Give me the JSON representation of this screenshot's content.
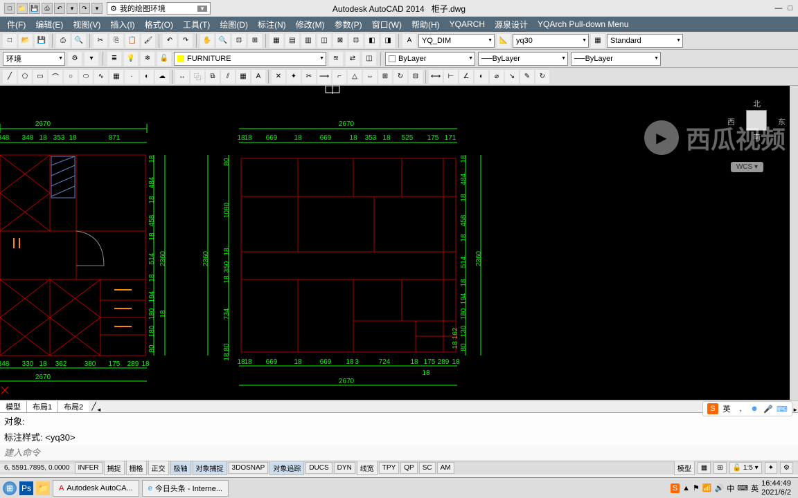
{
  "title": {
    "app": "Autodesk AutoCAD 2014",
    "file": "柜子.dwg"
  },
  "workspace": "我的绘图环境",
  "menus": [
    "件(F)",
    "编辑(E)",
    "视图(V)",
    "插入(I)",
    "格式(O)",
    "工具(T)",
    "绘图(D)",
    "标注(N)",
    "修改(M)",
    "参数(P)",
    "窗口(W)",
    "帮助(H)",
    "YQARCH",
    "源泉设计",
    "YQArch Pull-down Menu"
  ],
  "style_dd": {
    "text": "YQ_DIM",
    "style2": "yq30",
    "std": "Standard"
  },
  "layer": {
    "env": "环境",
    "current": "FURNITURE",
    "bylayer": "ByLayer",
    "bylayer2": "ByLayer",
    "bylayer3": "ByLayer"
  },
  "cmd": {
    "l1": "对象:",
    "l2": "标注样式:  <yq30>",
    "input": "建入命令"
  },
  "coord": "6, 5591.7895, 0.0000",
  "status_btns": [
    "INFER",
    "捕捉",
    "栅格",
    "正交",
    "极轴",
    "对象捕捉",
    "3DOSNAP",
    "对象追踪",
    "DUCS",
    "DYN",
    "线宽",
    "TPY",
    "QP",
    "SC",
    "AM"
  ],
  "status_right": {
    "model": "模型",
    "scale": "1:5"
  },
  "tabs": [
    "模型",
    "布局1",
    "布局2"
  ],
  "nav": {
    "n": "北",
    "s": "南",
    "e": "东",
    "w": "西"
  },
  "wcs": "WCS",
  "watermark": "西瓜视频",
  "taskbar": {
    "acad": "Autodesk AutoCA...",
    "ie": "今日头条 - Interne..."
  },
  "clock": {
    "time": "16:44:49",
    "date": "2021/6/2"
  },
  "tray": {
    "ime": "中",
    "kb": "英"
  },
  "ime": {
    "s": "S",
    "lang": "英"
  },
  "dims": {
    "left": {
      "top_total": "2670",
      "top": [
        "348",
        "348",
        "18",
        "353",
        "18",
        "871"
      ],
      "bot": [
        "348",
        "330",
        "18",
        "362",
        "380",
        "175",
        "289",
        "18"
      ],
      "bot_total": "2670",
      "right_v": [
        "18",
        "484",
        "18",
        "458",
        "18",
        "514",
        "18",
        "194",
        "180",
        "180",
        "80"
      ],
      "right_total": "2360",
      "mid_18": "18"
    },
    "right": {
      "top_total": "2670",
      "top": [
        "18",
        "18",
        "669",
        "18",
        "669",
        "18",
        "353",
        "18",
        "525",
        "175",
        "171"
      ],
      "bot": [
        "18",
        "18",
        "669",
        "18",
        "669",
        "18",
        "3",
        "724",
        "18",
        "175",
        "289",
        "18"
      ],
      "bot_18": "18",
      "bot_total": "2670",
      "left_v": [
        "80",
        "1080",
        "18",
        "350",
        "18",
        "734",
        "80",
        "18"
      ],
      "left_total": "2360",
      "right_v": [
        "18",
        "484",
        "18",
        "458",
        "18",
        "514",
        "18",
        "194",
        "180",
        "130",
        "80"
      ],
      "right_v2": [
        "162",
        "18"
      ],
      "right_total": "2360"
    }
  }
}
